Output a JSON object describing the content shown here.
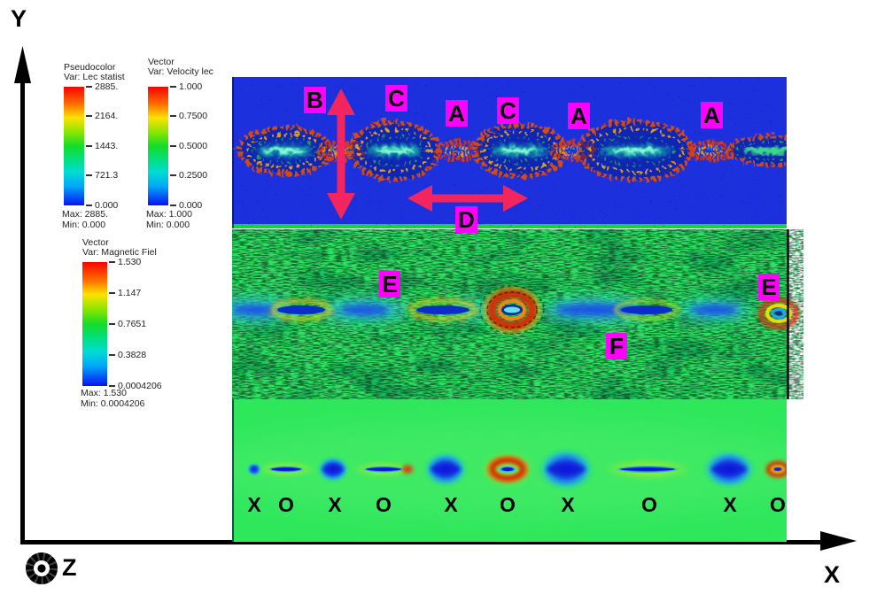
{
  "axes": {
    "x": "X",
    "y": "Y",
    "z": "Z"
  },
  "legends": [
    {
      "title": "Pseudocolor",
      "subtitle": "Var: Lec statist",
      "ticks": [
        "2885.",
        "2164.",
        "1443.",
        "721.3",
        "0.000"
      ],
      "max": "Max: 2885.",
      "min": "Min: 0.000"
    },
    {
      "title": "Vector",
      "subtitle": "Var: Velocity lec",
      "ticks": [
        "1.000",
        "0.7500",
        "0.5000",
        "0.2500",
        "0.000"
      ],
      "max": "Max: 1.000",
      "min": "Min: 0.000"
    },
    {
      "title": "Vector",
      "subtitle": "Var: Magnetic Fiel",
      "ticks": [
        "1.530",
        "1.147",
        "0.7651",
        "0.3828",
        "0.0004206"
      ],
      "max": "Max: 1.530",
      "min": "Min: 0.0004206"
    }
  ],
  "annotations": [
    {
      "label": "B"
    },
    {
      "label": "C"
    },
    {
      "label": "A"
    },
    {
      "label": "C"
    },
    {
      "label": "A"
    },
    {
      "label": "A"
    },
    {
      "label": "D"
    },
    {
      "label": "E"
    },
    {
      "label": "F"
    },
    {
      "label": "E"
    }
  ],
  "xo": [
    "X",
    "O",
    "X",
    "O",
    "X",
    "O",
    "X",
    "O",
    "X",
    "O"
  ],
  "colors": {
    "annotation_bg": "#ff00ff",
    "annotation_text": "#000000",
    "extent_arrow": "#f2255f",
    "panel1_bg": "#1c31dd",
    "panel2_bg": "#2de364",
    "panel3_bg": "#2ee75b"
  },
  "chart_data": {
    "type": "heatmap",
    "title": "",
    "xlabel": "X",
    "ylabel": "Y",
    "zlabel": "Z (out of plane)",
    "panels": [
      {
        "name": "particle-pseudocolor-panel",
        "plot": "pseudocolor particle scatter",
        "variable": "Lec statist",
        "value_range": [
          0.0,
          2885.0
        ],
        "colorbar_ticks": [
          2885,
          2164,
          1443,
          721.3,
          0.0
        ],
        "features": "chain of magnetic islands along midplane with speckled particle noise",
        "annotations": [
          "B vertical extent arrow",
          "C",
          "A",
          "C",
          "A",
          "A",
          "D horizontal extent arrow"
        ]
      },
      {
        "name": "magnetic-field-vector-panel",
        "plot": "vector field over pseudocolor",
        "variable": "Magnetic Fiel",
        "value_range": [
          0.0004206,
          1.53
        ],
        "colorbar_ticks": [
          1.53,
          1.147,
          0.7651,
          0.3828,
          0.0004206
        ],
        "annotations": [
          "E",
          "F",
          "E"
        ]
      },
      {
        "name": "flux-contour-panel",
        "plot": "smooth pseudocolor",
        "point_sequence": [
          "X",
          "O",
          "X",
          "O",
          "X",
          "O",
          "X",
          "O",
          "X",
          "O"
        ]
      }
    ],
    "velocity_legend": {
      "variable": "Velocity lec",
      "range": [
        0,
        1
      ],
      "ticks": [
        1.0,
        0.75,
        0.5,
        0.25,
        0.0
      ]
    }
  }
}
